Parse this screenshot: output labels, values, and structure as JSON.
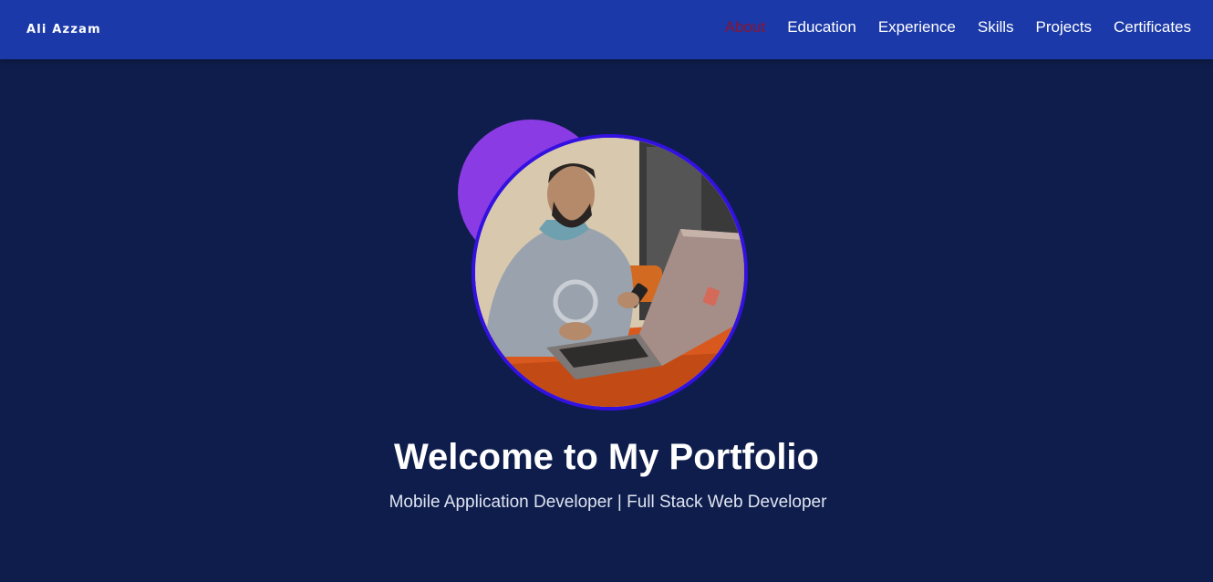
{
  "navbar": {
    "brand": "Ali Azzam",
    "links": [
      {
        "label": "About",
        "active": true
      },
      {
        "label": "Education",
        "active": false
      },
      {
        "label": "Experience",
        "active": false
      },
      {
        "label": "Skills",
        "active": false
      },
      {
        "label": "Projects",
        "active": false
      },
      {
        "label": "Certificates",
        "active": false
      }
    ]
  },
  "hero": {
    "title": "Welcome to My Portfolio",
    "subtitle": "Mobile Application Developer | Full Stack Web Developer"
  },
  "colors": {
    "navbar_bg": "#1b39a8",
    "page_bg": "#0e1d4b",
    "active_link": "#8a1530",
    "blob": "#8b3be3",
    "avatar_border": "#3311e0"
  }
}
